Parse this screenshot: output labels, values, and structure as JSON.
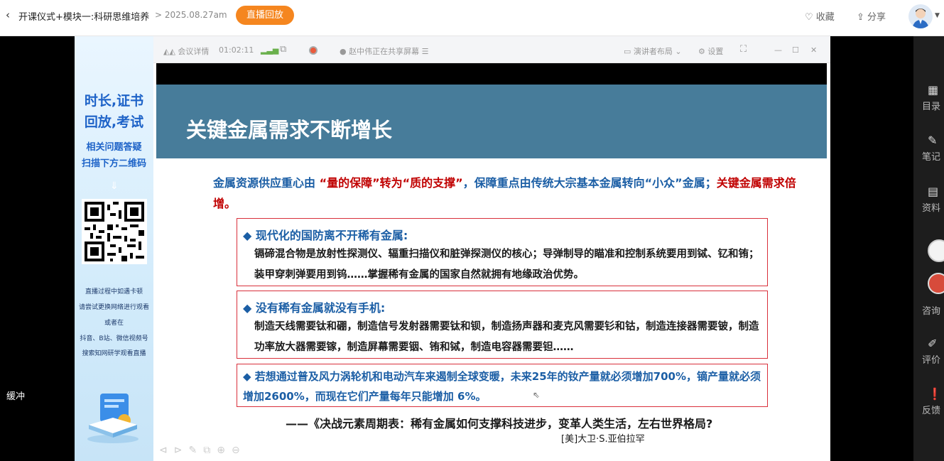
{
  "header": {
    "back_icon": "chevron-left-icon",
    "title": "开课仪式+模块一:科研思维培养",
    "date": "> 2025.08.27am",
    "replay_label": "直播回放",
    "favorite_label": "♡ 收藏",
    "share_label": "分享",
    "accent": "#f5861f"
  },
  "player": {
    "buffer_label": "缓冲"
  },
  "ad": {
    "line1": "时长,证书",
    "line2": "回放,考试",
    "line3": "相关问题答疑",
    "line4": "扫描下方二维码",
    "tip1": "直播过程中如遇卡顿",
    "tip2": "请尝试更换网络进行观看",
    "tip3": "或者在",
    "tip4": "抖音、B站、微信视频号",
    "tip5": "搜索知网研学观看直播"
  },
  "meeting": {
    "details_label": "会议详情",
    "timer": "01:02:11",
    "sharing_label": "赵中伟正在共享屏幕",
    "layout_label": "演讲者布局",
    "settings_label": "设置"
  },
  "slide": {
    "title": "关键金属需求不断增长",
    "intro_a": "金属资源供应重心由 ",
    "intro_b": "“量的保障”转为“质的支撑”",
    "intro_c": "，保障重点由传统大宗基本金属转向“小众”金属；",
    "intro_d": "关键金属需求倍增。",
    "box1_heading": "◆ 现代化的国防离不开稀有金属:",
    "box1_text": "镉碲混合物是放射性探测仪、辐重扫描仪和脏弹探测仪的核心；导弹制导的瞄准和控制系统要用到铽、钇和铕；装甲穿刺弹要用到钨……掌握稀有金属的国家自然就拥有地缘政治优势。",
    "box2_heading": "◆ 没有稀有金属就没有手机:",
    "box2_text": "制造天线需要钛和硼，制造信号发射器需要钛和钡，制造扬声器和麦克风需要钐和钴，制造连接器需要铍，制造功率放大器需要镓，制造屏幕需要铟、铕和铽，制造电容器需要钽……",
    "box3_text": "◆ 若想通过普及风力涡轮机和电动汽车来遏制全球变暖，未来25年的钕产量就必须增加700%，镝产量就必须增加2600%，而现在它们产量每年只能增加 6%。",
    "quote": "——《决战元素周期表：稀有金属如何支撑科技进步，变革人类生活，左右世界格局?",
    "author": "[美]大卫·S.亚伯拉罕"
  },
  "sidebar": {
    "items": [
      {
        "label": "目录",
        "icon": "grid-icon"
      },
      {
        "label": "笔记",
        "icon": "note-icon"
      },
      {
        "label": "资料",
        "icon": "folder-icon"
      },
      {
        "label": "咨询",
        "icon": "chat-icon"
      },
      {
        "label": "评价",
        "icon": "edit-icon"
      },
      {
        "label": "反馈",
        "icon": "feedback-icon"
      }
    ]
  }
}
